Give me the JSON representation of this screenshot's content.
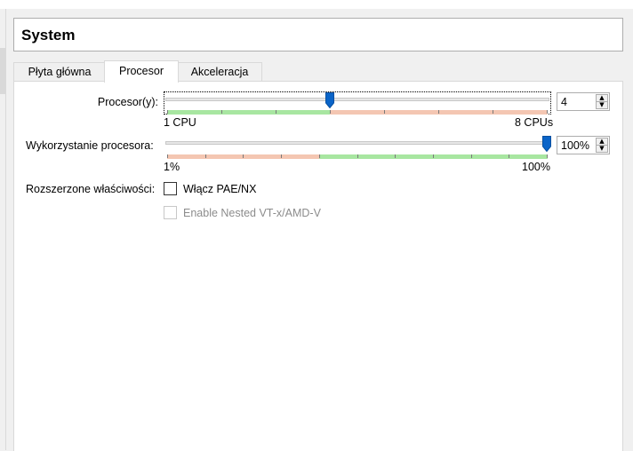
{
  "header": {
    "title": "System"
  },
  "tabs": [
    {
      "label": "Płyta główna",
      "active": false
    },
    {
      "label": "Procesor",
      "active": true
    },
    {
      "label": "Akceleracja",
      "active": false
    }
  ],
  "processor": {
    "label": "Procesor(y):",
    "value": "4",
    "min_label": "1 CPU",
    "max_label": "8 CPUs",
    "slider_min": 1,
    "slider_max": 8,
    "slider_value": 4
  },
  "usage": {
    "label": "Wykorzystanie procesora:",
    "value": "100%",
    "min_label": "1%",
    "max_label": "100%",
    "slider_min": 1,
    "slider_max": 100,
    "slider_value": 100
  },
  "extended": {
    "label": "Rozszerzone właściwości:",
    "pae_label": "Włącz PAE/NX",
    "pae_checked": false,
    "nested_label": "Enable Nested VT-x/AMD-V",
    "nested_checked": false,
    "nested_enabled": false
  },
  "colors": {
    "accent": "#0a64c8",
    "range_good": "#a8e6a1",
    "range_bad": "#f4c6b2"
  }
}
